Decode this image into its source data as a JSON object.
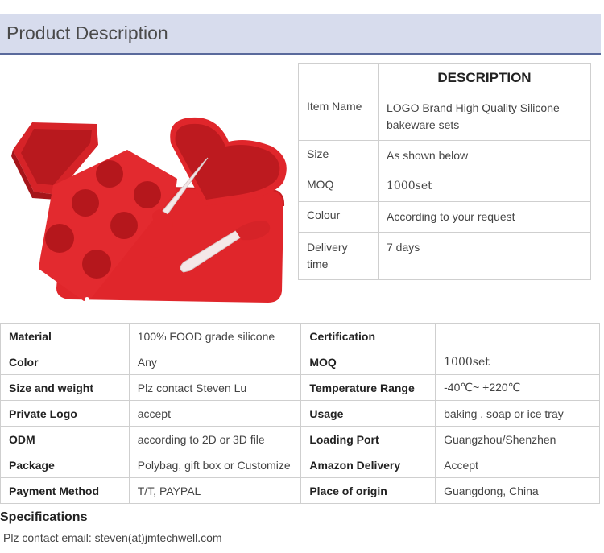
{
  "header": {
    "title": "Product Description"
  },
  "image": {
    "alt_icon": "silicone-bakeware-set-image"
  },
  "description": {
    "heading": "DESCRIPTION",
    "rows": [
      {
        "key": "Item Name",
        "value": "LOGO Brand High Quality Silicone bakeware sets"
      },
      {
        "key": "Size",
        "value": "As shown below"
      },
      {
        "key": "MOQ",
        "value": "1000set"
      },
      {
        "key": "Colour",
        "value": "According to your request"
      },
      {
        "key": "Delivery time",
        "value": "7 days"
      }
    ]
  },
  "specs": [
    {
      "k1": "Material",
      "v1": "100% FOOD grade silicone",
      "k2": "Certification",
      "v2": ""
    },
    {
      "k1": "Color",
      "v1": "Any",
      "k2": "MOQ",
      "v2": "1000set"
    },
    {
      "k1": "Size and weight",
      "v1": "Plz contact Steven Lu",
      "k2": "Temperature Range",
      "v2": "-40℃~ +220℃"
    },
    {
      "k1": "Private Logo",
      "v1": "accept",
      "k2": "Usage",
      "v2": "baking , soap or ice tray"
    },
    {
      "k1": "ODM",
      "v1": "according to 2D or 3D file",
      "k2": "Loading Port",
      "v2": "Guangzhou/Shenzhen"
    },
    {
      "k1": "Package",
      "v1": "Polybag, gift box or Customize",
      "k2": "Amazon Delivery",
      "v2": "Accept"
    },
    {
      "k1": "Payment Method",
      "v1": "T/T, PAYPAL",
      "k2": "Place of origin",
      "v2": "Guangdong, China"
    }
  ],
  "specifications": {
    "heading": "Specifications",
    "contact": "Plz contact email: steven(at)jmtechwell.com"
  },
  "colors": {
    "silicone_red": "#e0262b",
    "header_bg": "#d7dced",
    "header_border": "#5a6a9c"
  }
}
